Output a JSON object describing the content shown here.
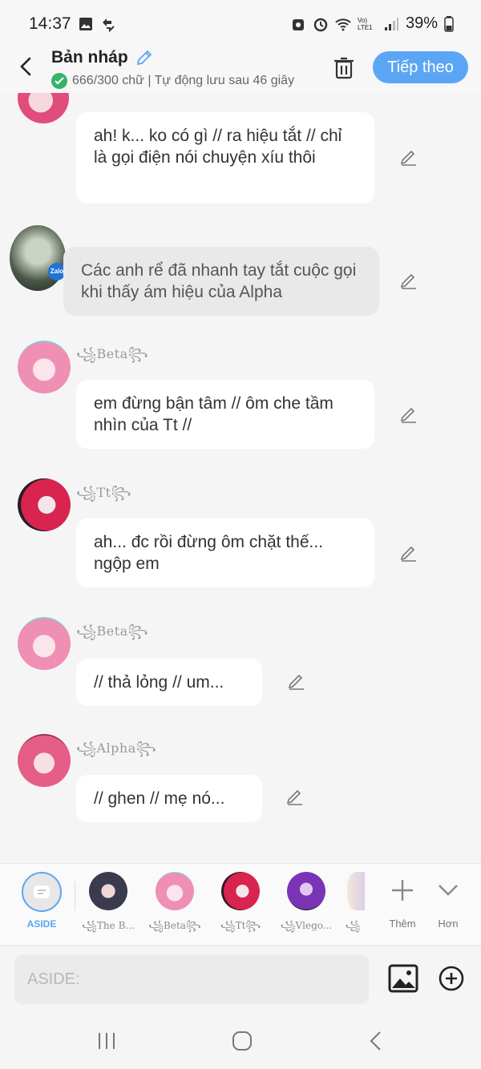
{
  "status_bar": {
    "time": "14:37",
    "battery": "39%",
    "signal_label": "Vo) LTE1"
  },
  "header": {
    "title": "Bản nháp",
    "subtitle": "666/300 chữ | Tự động lưu sau 46 giây",
    "next_label": "Tiếp theo"
  },
  "messages": [
    {
      "type": "character",
      "name": "",
      "text": "ah! k... ko có gì // ra hiệu tắt // chỉ là gọi điện nói chuyện xíu thôi"
    },
    {
      "type": "narrator",
      "badge": "Zalo",
      "text": "Các anh rể đã nhanh tay tắt cuộc gọi khi thấy ám hiệu của Alpha"
    },
    {
      "type": "character",
      "name": "꧁Beta꧂",
      "text": "em đừng bận tâm // ôm che tầm nhìn của Tt //"
    },
    {
      "type": "character",
      "name": "꧁Tt꧂",
      "text": "ah... đc rồi đừng ôm chặt thế... ngộp em"
    },
    {
      "type": "character",
      "name": "꧁Beta꧂",
      "text": "// thả lỏng // um..."
    },
    {
      "type": "character",
      "name": "꧁Alpha꧂",
      "text": "// ghen // mẹ nó..."
    }
  ],
  "character_bar": {
    "aside_label": "ASIDE",
    "items": [
      "꧁The B...",
      "꧁Beta꧂",
      "꧁Tt꧂",
      "꧁Vlego...",
      "꧁"
    ],
    "add_label": "Thêm",
    "more_label": "Hơn"
  },
  "input": {
    "placeholder": "ASIDE:"
  },
  "colors": {
    "accent": "#5ba6f4",
    "bubble": "#ffffff",
    "narrator_bubble": "#e9e9e9",
    "background": "#f5f5f5",
    "check": "#34b36b"
  },
  "icons": [
    "back-icon",
    "pencil-icon",
    "check-icon",
    "trash-icon",
    "edit-icon",
    "aside-icon",
    "plus-icon",
    "chevron-down-icon",
    "image-icon",
    "add-circle-icon",
    "recent-apps-icon",
    "home-icon",
    "nav-back-icon"
  ]
}
